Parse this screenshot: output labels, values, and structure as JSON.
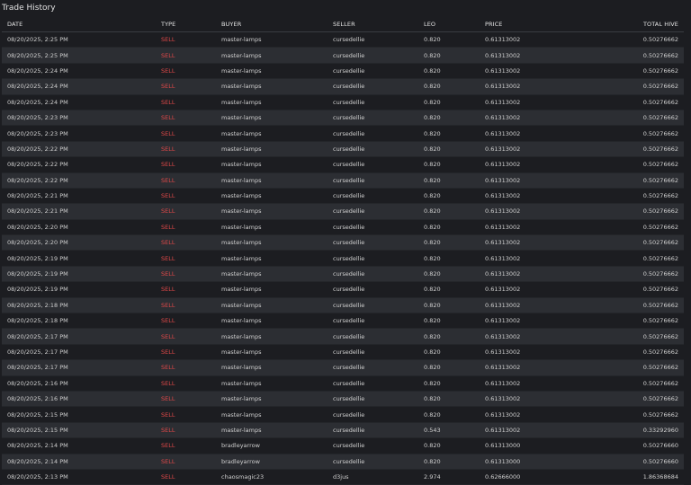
{
  "title": "Trade History",
  "columns": [
    "DATE",
    "TYPE",
    "BUYER",
    "SELLER",
    "LEO",
    "PRICE",
    "TOTAL HIVE"
  ],
  "colors": {
    "sell": "#e04848",
    "background": "#1c1d21",
    "row_alt": "#2c2e33"
  },
  "rows": [
    {
      "date": "08/20/2025, 2:25 PM",
      "type": "SELL",
      "buyer": "master-lamps",
      "seller": "cursedellie",
      "leo": "0.820",
      "price": "0.61313002",
      "total": "0.50276662"
    },
    {
      "date": "08/20/2025, 2:25 PM",
      "type": "SELL",
      "buyer": "master-lamps",
      "seller": "cursedellie",
      "leo": "0.820",
      "price": "0.61313002",
      "total": "0.50276662"
    },
    {
      "date": "08/20/2025, 2:24 PM",
      "type": "SELL",
      "buyer": "master-lamps",
      "seller": "cursedellie",
      "leo": "0.820",
      "price": "0.61313002",
      "total": "0.50276662"
    },
    {
      "date": "08/20/2025, 2:24 PM",
      "type": "SELL",
      "buyer": "master-lamps",
      "seller": "cursedellie",
      "leo": "0.820",
      "price": "0.61313002",
      "total": "0.50276662"
    },
    {
      "date": "08/20/2025, 2:24 PM",
      "type": "SELL",
      "buyer": "master-lamps",
      "seller": "cursedellie",
      "leo": "0.820",
      "price": "0.61313002",
      "total": "0.50276662"
    },
    {
      "date": "08/20/2025, 2:23 PM",
      "type": "SELL",
      "buyer": "master-lamps",
      "seller": "cursedellie",
      "leo": "0.820",
      "price": "0.61313002",
      "total": "0.50276662"
    },
    {
      "date": "08/20/2025, 2:23 PM",
      "type": "SELL",
      "buyer": "master-lamps",
      "seller": "cursedellie",
      "leo": "0.820",
      "price": "0.61313002",
      "total": "0.50276662"
    },
    {
      "date": "08/20/2025, 2:22 PM",
      "type": "SELL",
      "buyer": "master-lamps",
      "seller": "cursedellie",
      "leo": "0.820",
      "price": "0.61313002",
      "total": "0.50276662"
    },
    {
      "date": "08/20/2025, 2:22 PM",
      "type": "SELL",
      "buyer": "master-lamps",
      "seller": "cursedellie",
      "leo": "0.820",
      "price": "0.61313002",
      "total": "0.50276662"
    },
    {
      "date": "08/20/2025, 2:22 PM",
      "type": "SELL",
      "buyer": "master-lamps",
      "seller": "cursedellie",
      "leo": "0.820",
      "price": "0.61313002",
      "total": "0.50276662"
    },
    {
      "date": "08/20/2025, 2:21 PM",
      "type": "SELL",
      "buyer": "master-lamps",
      "seller": "cursedellie",
      "leo": "0.820",
      "price": "0.61313002",
      "total": "0.50276662"
    },
    {
      "date": "08/20/2025, 2:21 PM",
      "type": "SELL",
      "buyer": "master-lamps",
      "seller": "cursedellie",
      "leo": "0.820",
      "price": "0.61313002",
      "total": "0.50276662"
    },
    {
      "date": "08/20/2025, 2:20 PM",
      "type": "SELL",
      "buyer": "master-lamps",
      "seller": "cursedellie",
      "leo": "0.820",
      "price": "0.61313002",
      "total": "0.50276662"
    },
    {
      "date": "08/20/2025, 2:20 PM",
      "type": "SELL",
      "buyer": "master-lamps",
      "seller": "cursedellie",
      "leo": "0.820",
      "price": "0.61313002",
      "total": "0.50276662"
    },
    {
      "date": "08/20/2025, 2:19 PM",
      "type": "SELL",
      "buyer": "master-lamps",
      "seller": "cursedellie",
      "leo": "0.820",
      "price": "0.61313002",
      "total": "0.50276662"
    },
    {
      "date": "08/20/2025, 2:19 PM",
      "type": "SELL",
      "buyer": "master-lamps",
      "seller": "cursedellie",
      "leo": "0.820",
      "price": "0.61313002",
      "total": "0.50276662"
    },
    {
      "date": "08/20/2025, 2:19 PM",
      "type": "SELL",
      "buyer": "master-lamps",
      "seller": "cursedellie",
      "leo": "0.820",
      "price": "0.61313002",
      "total": "0.50276662"
    },
    {
      "date": "08/20/2025, 2:18 PM",
      "type": "SELL",
      "buyer": "master-lamps",
      "seller": "cursedellie",
      "leo": "0.820",
      "price": "0.61313002",
      "total": "0.50276662"
    },
    {
      "date": "08/20/2025, 2:18 PM",
      "type": "SELL",
      "buyer": "master-lamps",
      "seller": "cursedellie",
      "leo": "0.820",
      "price": "0.61313002",
      "total": "0.50276662"
    },
    {
      "date": "08/20/2025, 2:17 PM",
      "type": "SELL",
      "buyer": "master-lamps",
      "seller": "cursedellie",
      "leo": "0.820",
      "price": "0.61313002",
      "total": "0.50276662"
    },
    {
      "date": "08/20/2025, 2:17 PM",
      "type": "SELL",
      "buyer": "master-lamps",
      "seller": "cursedellie",
      "leo": "0.820",
      "price": "0.61313002",
      "total": "0.50276662"
    },
    {
      "date": "08/20/2025, 2:17 PM",
      "type": "SELL",
      "buyer": "master-lamps",
      "seller": "cursedellie",
      "leo": "0.820",
      "price": "0.61313002",
      "total": "0.50276662"
    },
    {
      "date": "08/20/2025, 2:16 PM",
      "type": "SELL",
      "buyer": "master-lamps",
      "seller": "cursedellie",
      "leo": "0.820",
      "price": "0.61313002",
      "total": "0.50276662"
    },
    {
      "date": "08/20/2025, 2:16 PM",
      "type": "SELL",
      "buyer": "master-lamps",
      "seller": "cursedellie",
      "leo": "0.820",
      "price": "0.61313002",
      "total": "0.50276662"
    },
    {
      "date": "08/20/2025, 2:15 PM",
      "type": "SELL",
      "buyer": "master-lamps",
      "seller": "cursedellie",
      "leo": "0.820",
      "price": "0.61313002",
      "total": "0.50276662"
    },
    {
      "date": "08/20/2025, 2:15 PM",
      "type": "SELL",
      "buyer": "master-lamps",
      "seller": "cursedellie",
      "leo": "0.543",
      "price": "0.61313002",
      "total": "0.33292960"
    },
    {
      "date": "08/20/2025, 2:14 PM",
      "type": "SELL",
      "buyer": "bradleyarrow",
      "seller": "cursedellie",
      "leo": "0.820",
      "price": "0.61313000",
      "total": "0.50276660"
    },
    {
      "date": "08/20/2025, 2:14 PM",
      "type": "SELL",
      "buyer": "bradleyarrow",
      "seller": "cursedellie",
      "leo": "0.820",
      "price": "0.61313000",
      "total": "0.50276660"
    },
    {
      "date": "08/20/2025, 2:13 PM",
      "type": "SELL",
      "buyer": "chaosmagic23",
      "seller": "d3jus",
      "leo": "2.974",
      "price": "0.62666000",
      "total": "1.86368684"
    }
  ]
}
